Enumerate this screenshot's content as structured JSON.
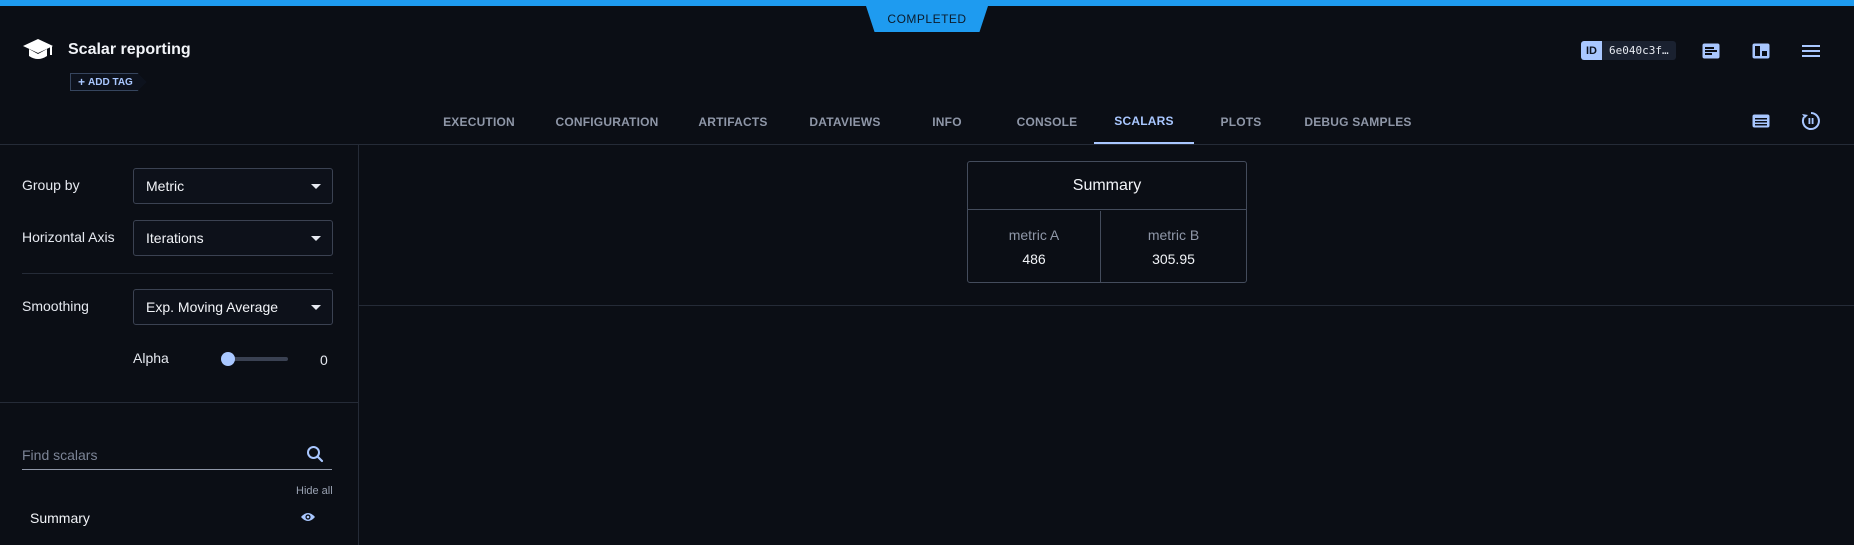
{
  "header": {
    "status": "COMPLETED",
    "task_title": "Scalar reporting",
    "add_tag_label": "ADD TAG",
    "id_label": "ID",
    "id_value": "6e040c3f…",
    "icons": [
      "details-icon",
      "panel-layout-icon",
      "menu-icon"
    ]
  },
  "tabs": [
    {
      "label": "EXECUTION",
      "active": false
    },
    {
      "label": "CONFIGURATION",
      "active": false
    },
    {
      "label": "ARTIFACTS",
      "active": false
    },
    {
      "label": "DATAVIEWS",
      "active": false
    },
    {
      "label": "INFO",
      "active": false
    },
    {
      "label": "CONSOLE",
      "active": false
    },
    {
      "label": "SCALARS",
      "active": true
    },
    {
      "label": "PLOTS",
      "active": false
    },
    {
      "label": "DEBUG SAMPLES",
      "active": false
    }
  ],
  "tab_icons": [
    "list-view-icon",
    "auto-refresh-icon"
  ],
  "sidebar": {
    "group_by_label": "Group by",
    "group_by_value": "Metric",
    "horizontal_axis_label": "Horizontal Axis",
    "horizontal_axis_value": "Iterations",
    "smoothing_label": "Smoothing",
    "smoothing_value": "Exp. Moving Average",
    "alpha_label": "Alpha",
    "alpha_value": "0",
    "alpha_fraction": 0,
    "search_placeholder": "Find scalars",
    "hide_all_label": "Hide all",
    "items": [
      {
        "label": "Summary",
        "visible": true
      }
    ]
  },
  "summary": {
    "title": "Summary",
    "metrics": [
      {
        "name": "metric A",
        "value": "486"
      },
      {
        "name": "metric B",
        "value": "305.95"
      }
    ]
  },
  "colors": {
    "accent": "#1e9bf0",
    "active_tab": "#a9c7ff",
    "background": "#0b0e15"
  }
}
